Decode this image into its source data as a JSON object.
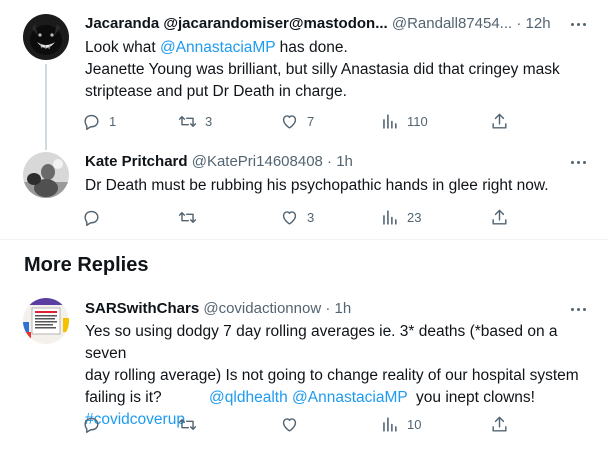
{
  "tweets": [
    {
      "name": "Jacaranda @jacarandomiser@mastodon...",
      "handle": "@Randall87454...",
      "dot": "·",
      "time": "12h",
      "body": [
        [
          {
            "text": "Look what "
          },
          {
            "text": "@AnnastaciaMP",
            "link": true
          },
          {
            "text": " has done."
          }
        ],
        [
          {
            "text": "Jeanette Young was brilliant, but silly Anastasia did that cringey mask"
          }
        ],
        [
          {
            "text": "striptease and put Dr Death in charge."
          }
        ]
      ],
      "replies": "1",
      "retweets": "3",
      "likes": "7",
      "views": "110"
    },
    {
      "name": "Kate Pritchard",
      "handle": "@KatePri14608408",
      "dot": "·",
      "time": "1h",
      "body": [
        [
          {
            "text": "Dr Death must be rubbing his psychopathic hands in glee right now."
          }
        ]
      ],
      "replies": "",
      "retweets": "",
      "likes": "3",
      "views": "23"
    },
    {
      "name": "SARSwithChars",
      "handle": "@covidactionnow",
      "dot": "·",
      "time": "1h",
      "body": [
        [
          {
            "text": "Yes so using dodgy 7 day rolling averages ie.  3* deaths (*based on a seven"
          }
        ],
        [
          {
            "text": "day rolling average) Is not going to change reality of our hospital system"
          }
        ],
        [
          {
            "text": "failing is it?           "
          },
          {
            "text": "@qldhealth",
            "link": true
          },
          {
            "text": " "
          },
          {
            "text": "@AnnastaciaMP",
            "link": true
          },
          {
            "text": "  you inept clowns!"
          }
        ],
        [
          {
            "text": "#covidcoverup",
            "link": true
          }
        ]
      ],
      "replies": "",
      "retweets": "",
      "likes": "",
      "views": "10"
    }
  ],
  "section": {
    "more_replies": "More Replies"
  },
  "icons": {
    "reply": "reply-icon",
    "retweet": "retweet-icon",
    "like": "heart-icon",
    "views": "views-icon",
    "share": "share-icon",
    "more": "more-icon"
  },
  "colors": {
    "link": "#1d9bf0",
    "muted": "#536471",
    "text": "#0f1419",
    "divider": "#eff3f4"
  }
}
